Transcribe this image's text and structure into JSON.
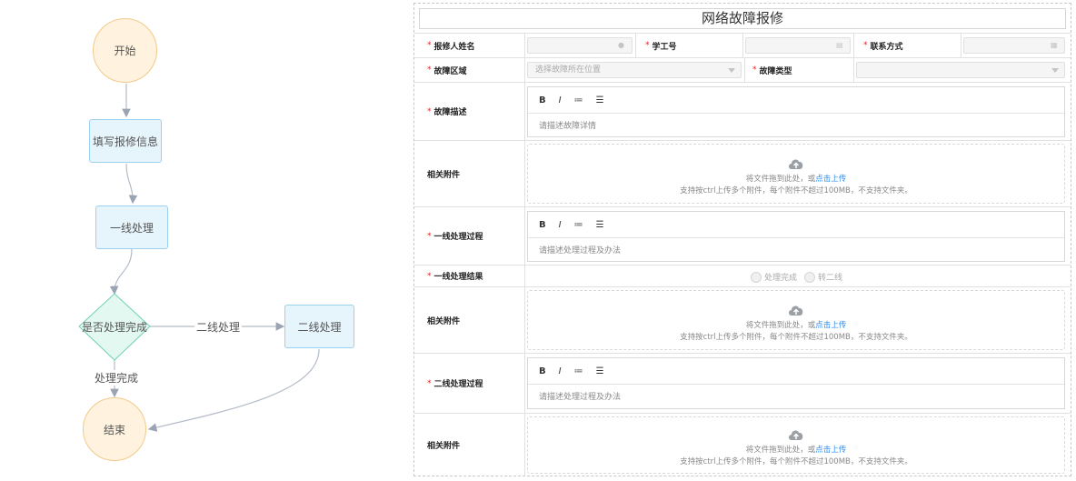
{
  "flowchart": {
    "start": "开始",
    "fill_info": "填写报修信息",
    "first_line": "一线处理",
    "decision": "是否处理完成",
    "second_line": "二线处理",
    "end": "结束",
    "edge_second_line": "二线处理",
    "edge_done": "处理完成"
  },
  "form": {
    "title": "网络故障报修",
    "reporter_name_label": "报修人姓名",
    "student_id_label": "学工号",
    "contact_label": "联系方式",
    "fault_area_label": "故障区域",
    "fault_area_placeholder": "选择故障所在位置",
    "fault_type_label": "故障类型",
    "fault_desc_label": "故障描述",
    "fault_desc_placeholder": "请描述故障详情",
    "attachments_label": "相关附件",
    "first_process_label": "一线处理过程",
    "first_process_placeholder": "请描述处理过程及办法",
    "first_result_label": "一线处理结果",
    "result_options": [
      "处理完成",
      "转二线"
    ],
    "second_process_label": "二线处理过程",
    "second_process_placeholder": "请描述处理过程及办法",
    "toolbar": {
      "bold": "B",
      "italic": "I",
      "ordered_list": "≔",
      "bullet_list": "☰"
    },
    "upload": {
      "drag_text": "将文件拖到此处，或",
      "click_text": "点击上传",
      "hint": "支持按ctrl上传多个附件，每个附件不超过100MB，不支持文件夹。"
    },
    "required_mark": "*"
  },
  "colors": {
    "circle_fill": "#fff3df",
    "rect_fill": "#e6f4fc",
    "decision_fill": "#e3f8f1",
    "link": "#2d8cf0",
    "required": "#e02020"
  }
}
